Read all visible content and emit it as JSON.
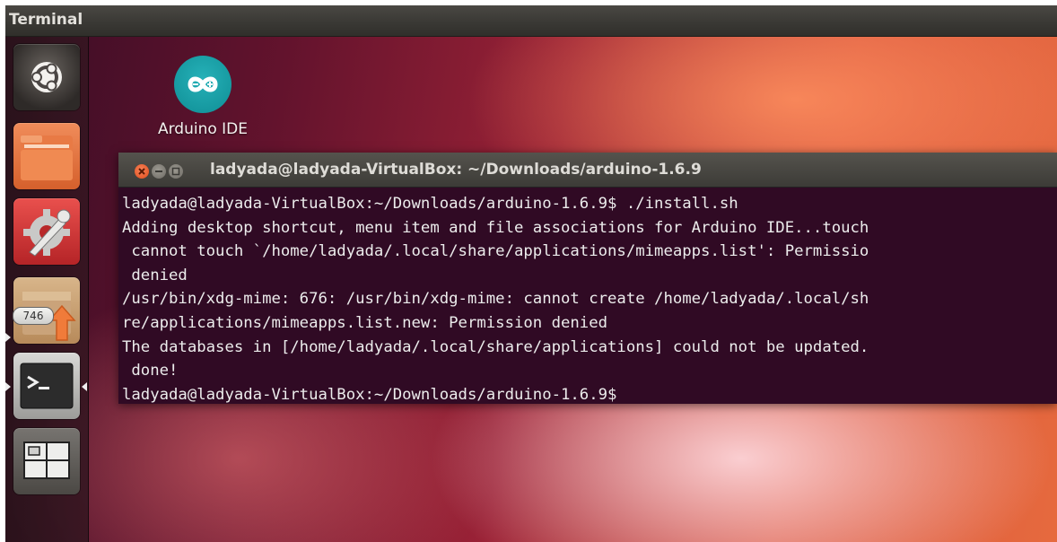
{
  "top_panel": {
    "title": "Terminal"
  },
  "launcher": {
    "items": [
      {
        "name": "Dash",
        "icon": "ubuntu-logo-icon"
      },
      {
        "name": "Files",
        "icon": "folder-icon"
      },
      {
        "name": "System Settings",
        "icon": "gear-wrench-icon"
      },
      {
        "name": "Software Updater",
        "icon": "update-arrow-icon",
        "badge": "746"
      },
      {
        "name": "Terminal",
        "icon": "terminal-icon",
        "active": true
      },
      {
        "name": "Workspaces",
        "icon": "workspace-switcher-icon"
      }
    ]
  },
  "desktop": {
    "icons": [
      {
        "label": "Arduino IDE",
        "icon": "arduino-infinity-icon"
      }
    ]
  },
  "terminal": {
    "window_title": "ladyada@ladyada-VirtualBox: ~/Downloads/arduino-1.6.9",
    "lines": [
      "ladyada@ladyada-VirtualBox:~/Downloads/arduino-1.6.9$ ./install.sh",
      "Adding desktop shortcut, menu item and file associations for Arduino IDE...touch",
      " cannot touch `/home/ladyada/.local/share/applications/mimeapps.list': Permissio",
      " denied",
      "/usr/bin/xdg-mime: 676: /usr/bin/xdg-mime: cannot create /home/ladyada/.local/sh",
      "re/applications/mimeapps.list.new: Permission denied",
      "The databases in [/home/ladyada/.local/share/applications] could not be updated.",
      " done!",
      "ladyada@ladyada-VirtualBox:~/Downloads/arduino-1.6.9$"
    ]
  },
  "colors": {
    "terminal_bg": "#300a24",
    "terminal_fg": "#ececec",
    "close_button": "#e8542a",
    "arduino_teal": "#17a1a8"
  }
}
